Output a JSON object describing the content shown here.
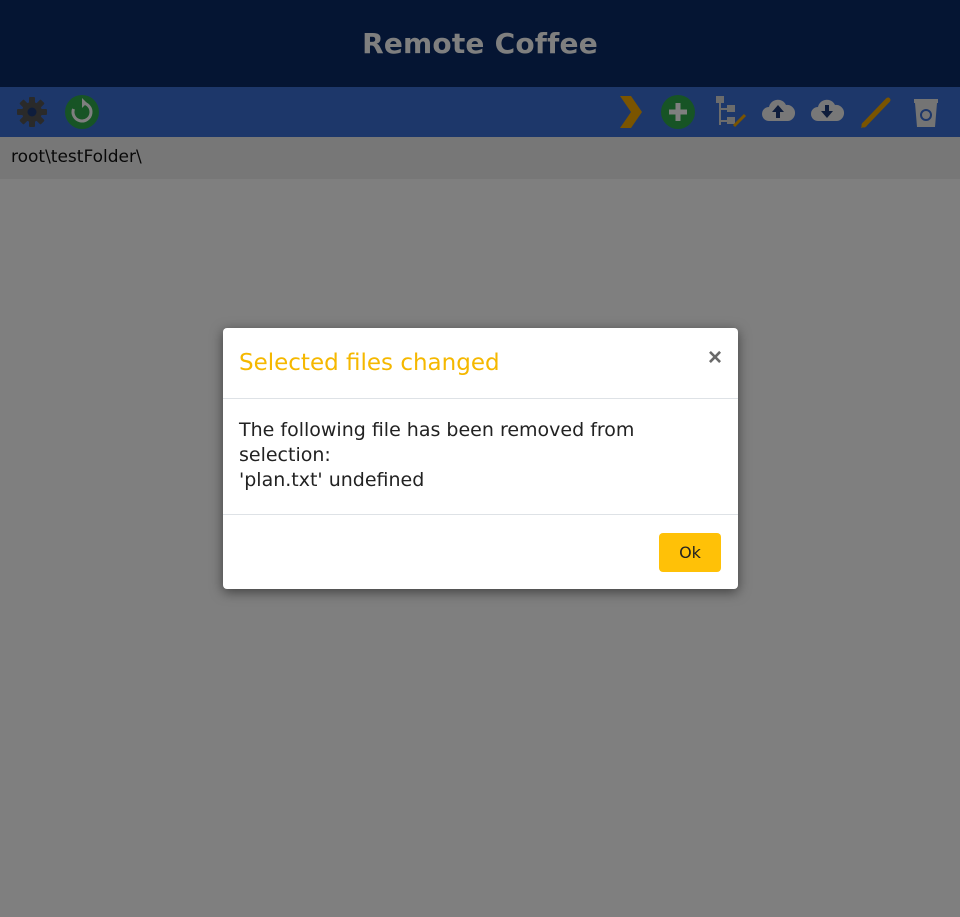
{
  "app": {
    "title": "Remote Coffee"
  },
  "toolbar": {
    "left": [
      {
        "name": "settings",
        "icon": "gear-icon"
      },
      {
        "name": "refresh",
        "icon": "refresh-icon"
      }
    ],
    "right": [
      {
        "name": "next",
        "icon": "chevron-right-icon"
      },
      {
        "name": "add",
        "icon": "plus-circle-icon"
      },
      {
        "name": "move",
        "icon": "folder-tree-icon"
      },
      {
        "name": "upload",
        "icon": "cloud-upload-icon"
      },
      {
        "name": "download",
        "icon": "cloud-download-icon"
      },
      {
        "name": "rename",
        "icon": "pencil-icon"
      },
      {
        "name": "delete",
        "icon": "recycle-bin-icon"
      }
    ]
  },
  "path": {
    "text": "root\\testFolder\\"
  },
  "colors": {
    "header_bg": "#0a2a66",
    "toolbar_bg": "#3b6fd4",
    "accent": "#ffc107",
    "title_accent": "#f5b800",
    "green": "#2ea84a"
  },
  "modal": {
    "title": "Selected files changed",
    "close_label": "×",
    "body_line1": "The following file has been removed from selection:",
    "body_line2": "'plan.txt' undefined",
    "ok_label": "Ok"
  }
}
